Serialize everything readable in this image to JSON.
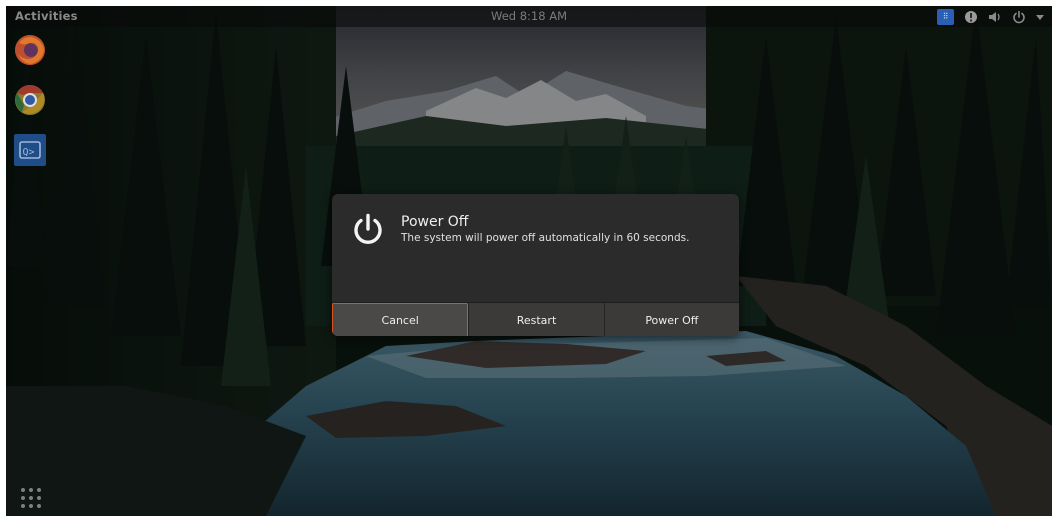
{
  "topbar": {
    "activities_label": "Activities",
    "clock": "Wed  8:18 AM",
    "tray_icons": [
      "keyboard-layout-icon",
      "notification-icon",
      "volume-icon",
      "power-icon",
      "chevron-down-icon"
    ]
  },
  "dock": {
    "apps": [
      {
        "name": "Firefox",
        "icon": "firefox-icon"
      },
      {
        "name": "Chrome",
        "icon": "chrome-icon"
      },
      {
        "name": "Terminal",
        "icon": "terminal-icon"
      }
    ],
    "app_grid_icon": "app-grid-icon"
  },
  "dialog": {
    "title": "Power Off",
    "message": "The system will power off automatically in 60 seconds.",
    "icon": "power-icon",
    "buttons": {
      "cancel": "Cancel",
      "restart": "Restart",
      "power_off": "Power Off"
    },
    "focused_button": "cancel",
    "accent_color": "#d9531e"
  }
}
